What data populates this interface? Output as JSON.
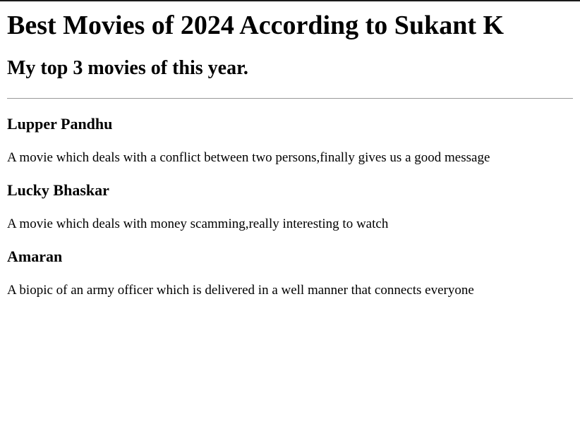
{
  "header": {
    "title": "Best Movies of 2024 According to Sukant K",
    "subtitle": "My top 3 movies of this year."
  },
  "movies": [
    {
      "title": "Lupper Pandhu",
      "description": "A movie which deals with a conflict between two persons,finally gives us a good message"
    },
    {
      "title": "Lucky Bhaskar",
      "description": "A movie which deals with money scamming,really interesting to watch"
    },
    {
      "title": "Amaran",
      "description": "A biopic of an army officer which is delivered in a well manner that connects everyone"
    }
  ]
}
